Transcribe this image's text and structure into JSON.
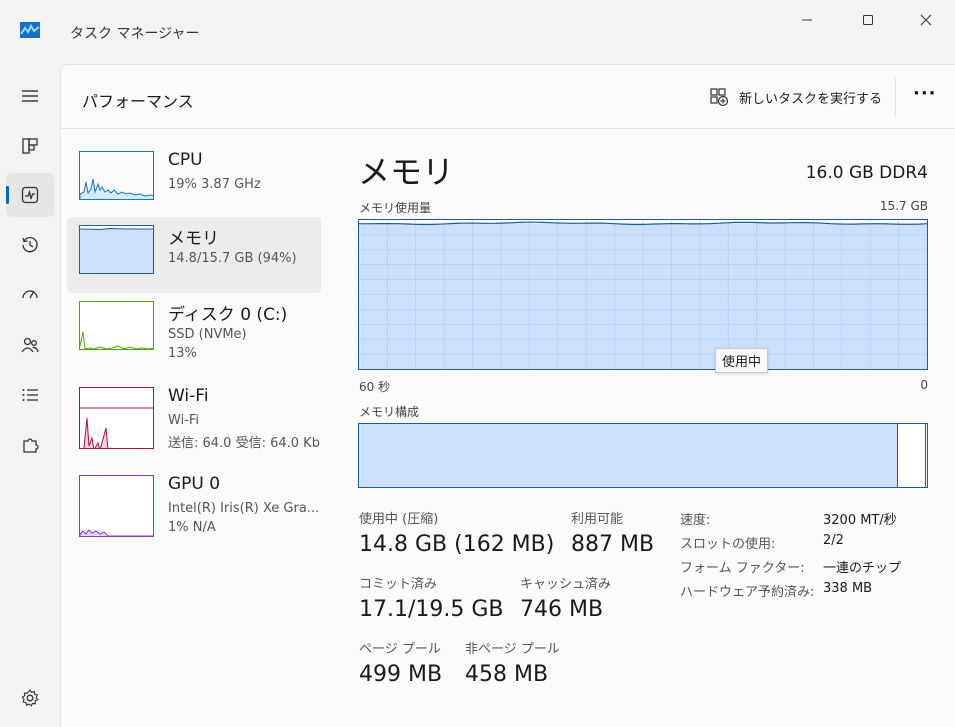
{
  "window": {
    "title": "タスク マネージャー"
  },
  "header": {
    "title": "パフォーマンス",
    "new_task_label": "新しいタスクを実行する"
  },
  "devices": [
    {
      "name": "CPU",
      "line1": "19%  3.87 GHz",
      "line2": ""
    },
    {
      "name": "メモリ",
      "line1": "14.8/15.7 GB (94%)",
      "line2": ""
    },
    {
      "name": "ディスク 0 (C:)",
      "line1": "SSD (NVMe)",
      "line2": "13%"
    },
    {
      "name": "Wi-Fi",
      "line1": "Wi-Fi",
      "line2": "送信: 64.0  受信: 64.0 Kb"
    },
    {
      "name": "GPU 0",
      "line1": "Intel(R) Iris(R) Xe Gra...",
      "line2": "1%  N/A"
    }
  ],
  "detail": {
    "title": "メモリ",
    "spec": "16.0 GB DDR4",
    "usage_label": "メモリ使用量",
    "usage_max": "15.7 GB",
    "axis_left": "60 秒",
    "axis_right": "0",
    "tooltip": "使用中",
    "composition_label": "メモリ構成",
    "usage_fraction": 0.94
  },
  "stats": {
    "in_use_label": "使用中 (圧縮)",
    "in_use_value": "14.8 GB (162 MB)",
    "available_label": "利用可能",
    "available_value": "887 MB",
    "committed_label": "コミット済み",
    "committed_value": "17.1/19.5 GB",
    "cached_label": "キャッシュ済み",
    "cached_value": "746 MB",
    "paged_label": "ページ プール",
    "paged_value": "499 MB",
    "nonpaged_label": "非ページ プール",
    "nonpaged_value": "458 MB"
  },
  "specs": [
    {
      "key": "速度:",
      "value": "3200 MT/秒"
    },
    {
      "key": "スロットの使用:",
      "value": "2/2"
    },
    {
      "key": "フォーム ファクター:",
      "value": "一連のチップ"
    },
    {
      "key": "ハードウェア予約済み:",
      "value": "338 MB"
    }
  ],
  "colors": {
    "accent": "#0067c0",
    "memory_fill": "#cce0fb",
    "memory_line": "#1e5b9a",
    "cpu": "#117dbb",
    "disk": "#4da60c",
    "wifi": "#a7114a",
    "gpu": "#8e39c9"
  }
}
